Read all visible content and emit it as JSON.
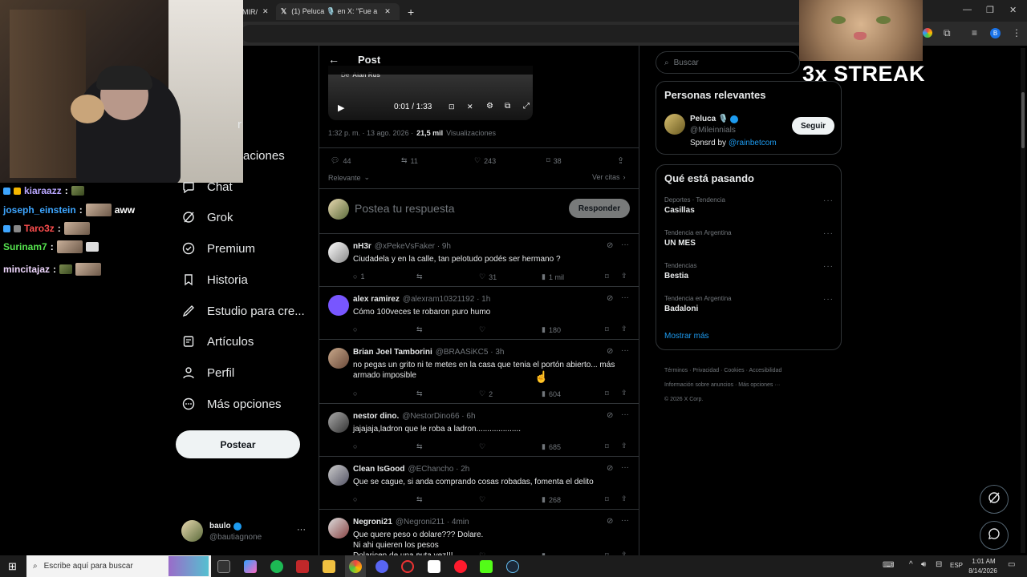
{
  "browser": {
    "tabs": [
      {
        "label": "MIR/"
      },
      {
        "label": "(1) Peluca 🎙️ en X: \"Fue a vend"
      }
    ],
    "new_tab": "+"
  },
  "overlay": {
    "streak": "3x STREAK",
    "chat": [
      {
        "user": "kiaraazz",
        "message": "",
        "color": "#b9a7ff"
      },
      {
        "user": "joseph_einstein",
        "message": "aww",
        "color": "#3ea6ff"
      },
      {
        "user": "Taro3z",
        "message": "",
        "color": "#ff4e4e"
      },
      {
        "user": "Surinam7",
        "message": "",
        "color": "#55e34e"
      },
      {
        "user": "mincitajaz",
        "message": "",
        "color": "#f0d8ff"
      }
    ]
  },
  "nav": {
    "partial_items": [
      "r",
      "aciones"
    ],
    "items": [
      {
        "label": "Chat",
        "icon": "chat-icon"
      },
      {
        "label": "Grok",
        "icon": "grok-icon"
      },
      {
        "label": "Premium",
        "icon": "premium-icon"
      },
      {
        "label": "Historia",
        "icon": "bookmark-icon"
      },
      {
        "label": "Estudio para cre...",
        "icon": "studio-icon"
      },
      {
        "label": "Artículos",
        "icon": "articles-icon"
      },
      {
        "label": "Perfil",
        "icon": "profile-icon"
      },
      {
        "label": "Más opciones",
        "icon": "more-icon"
      }
    ],
    "post_button": "Postear",
    "account": {
      "name": "baulo",
      "handle": "@bautiagnone",
      "more": "···"
    }
  },
  "post": {
    "header_title": "Post",
    "video": {
      "source": "De",
      "source_name": "Alan Rus",
      "time": "0:01 / 1:33"
    },
    "meta": {
      "time": "1:32 p. m. · 13 ago. 2026 ·",
      "views": "21,5 mil",
      "views_label": "Visualizaciones"
    },
    "stats": {
      "replies": "44",
      "reposts": "11",
      "likes": "243",
      "bookmarks": "38"
    },
    "sort_label": "Relevante",
    "quotes_label": "Ver citas",
    "reply_placeholder": "Postea tu respuesta",
    "reply_button": "Responder"
  },
  "replies": [
    {
      "name": "nH3r",
      "handle": "@xPekeVsFaker · 9h",
      "text": "Ciudadela y en la calle, tan pelotudo podés ser hermano ?",
      "replies": "1",
      "likes": "31",
      "views": "1 mil"
    },
    {
      "name": "alex ramirez",
      "handle": "@alexram10321192 · 1h",
      "text": "Cómo 100veces te robaron puro humo",
      "replies": "",
      "likes": "",
      "views": "180"
    },
    {
      "name": "Brian Joel Tamborini",
      "handle": "@BRAASiKC5 · 3h",
      "text": "no pegas un grito ni te metes en la casa que tenia el portón abierto... más armado imposible",
      "replies": "",
      "likes": "2",
      "views": "604"
    },
    {
      "name": "nestor dino.",
      "handle": "@NestorDino66 · 6h",
      "text": "jajajaja,ladron que le roba a ladron....................",
      "replies": "",
      "likes": "",
      "views": "685"
    },
    {
      "name": "Clean IsGood",
      "handle": "@EChancho · 2h",
      "text": "Que se cague, si anda comprando cosas robadas, fomenta el delito",
      "replies": "",
      "likes": "",
      "views": "268"
    },
    {
      "name": "Negroni21",
      "handle": "@Negroni211 · 4min",
      "text": "Que quere peso o dolare??? Dolare.\nNi ahi quieren los pesos\nDolaricen de una puta vez!!!",
      "replies": "",
      "likes": "",
      "views": ""
    }
  ],
  "sidebar": {
    "search_placeholder": "Buscar",
    "relevant_title": "Personas relevantes",
    "person": {
      "name": "Peluca 🎙️",
      "handle": "@Mileinnials",
      "bio_prefix": "Spnsrd by",
      "bio_link": "@rainbetcom",
      "follow": "Seguir"
    },
    "trends_title": "Qué está pasando",
    "trends": [
      {
        "category": "Deportes · Tendencia",
        "name": "Casillas"
      },
      {
        "category": "Tendencia en Argentina",
        "name": "UN MES"
      },
      {
        "category": "Tendencias",
        "name": "Bestia"
      },
      {
        "category": "Tendencia en Argentina",
        "name": "Badaloni"
      }
    ],
    "show_more": "Mostrar más",
    "footer": [
      "Términos",
      "Privacidad",
      "Cookies",
      "Accesibilidad",
      "Información sobre anuncios",
      "Más opciones ···",
      "© 2026 X Corp."
    ]
  },
  "taskbar": {
    "search_placeholder": "Escribe aquí para buscar",
    "lang": "ESP",
    "time": "1:01 AM",
    "date": "8/14/2026"
  },
  "colors": {
    "accent": "#1d9bf0",
    "background": "#000000",
    "border": "#2f3336",
    "muted": "#71767b"
  }
}
